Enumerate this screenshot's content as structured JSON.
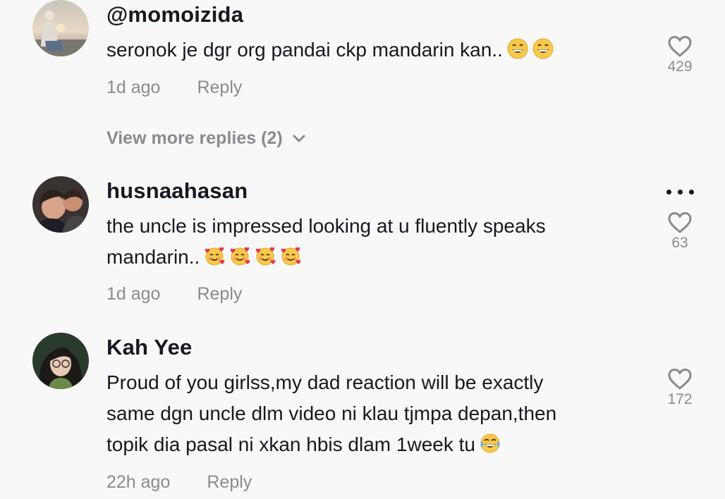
{
  "comments": [
    {
      "username": "@momoizida",
      "text": "seronok je dgr org pandai ckp mandarin kan..",
      "emojis": [
        "grinning-face-emoji",
        "grinning-face-emoji"
      ],
      "time": "1d ago",
      "reply_label": "Reply",
      "likes": "429"
    },
    {
      "username": "husnaahasan",
      "text_lines": [
        "the uncle is impressed looking at u fluently speaks",
        "mandarin.."
      ],
      "emojis": [
        "smiling-face-with-hearts-emoji",
        "smiling-face-with-hearts-emoji",
        "smiling-face-with-hearts-emoji",
        "smiling-face-with-hearts-emoji"
      ],
      "time": "1d ago",
      "reply_label": "Reply",
      "likes": "63"
    },
    {
      "username": "Kah Yee",
      "text_lines": [
        "Proud of you girlss,my dad reaction will be exactly",
        "same dgn uncle dlm video ni klau tjmpa depan,then",
        "topik dia pasal ni xkan hbis dlam 1week tu"
      ],
      "emojis": [
        "face-with-tears-of-joy-emoji"
      ],
      "time": "22h ago",
      "reply_label": "Reply",
      "likes": "172"
    }
  ],
  "view_more_replies": "View more replies (2)",
  "colors": {
    "background": "#f8f8f8",
    "text": "#161823",
    "muted": "#8a8b91"
  }
}
